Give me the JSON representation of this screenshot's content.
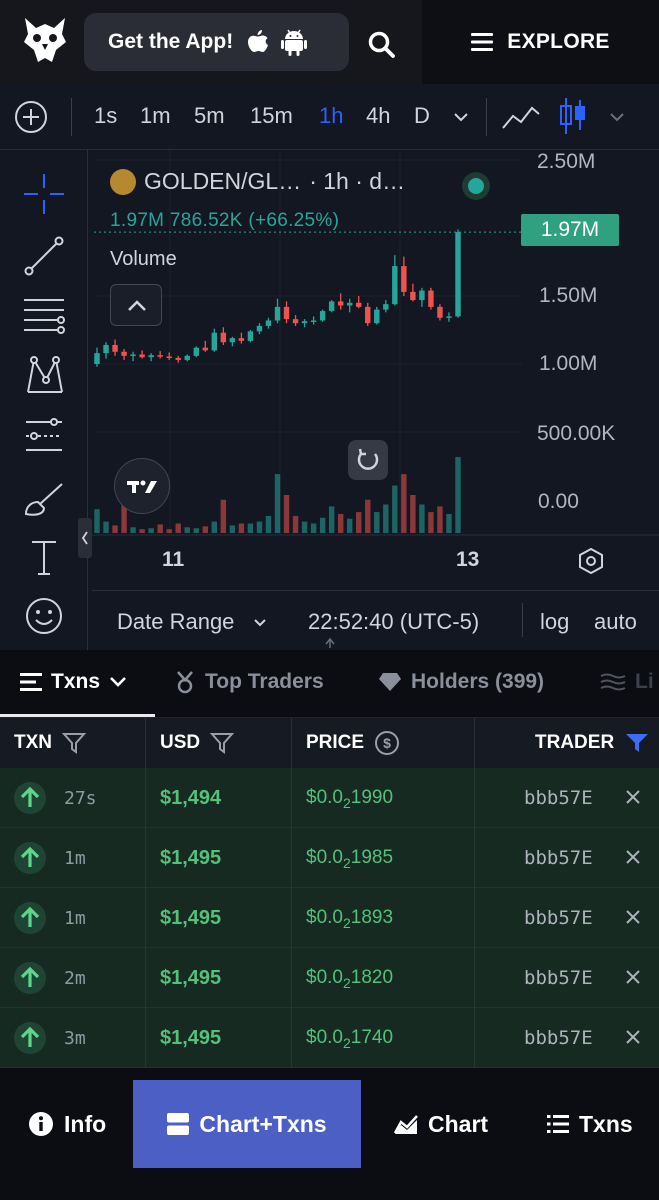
{
  "header": {
    "get_app_label": "Get the App!",
    "explore_label": "EXPLORE",
    "icons": [
      "owl-logo-icon",
      "apple-icon",
      "android-icon",
      "search-icon",
      "menu-icon"
    ]
  },
  "chart_toolbar": {
    "timeframes": [
      "1s",
      "1m",
      "5m",
      "15m",
      "1h",
      "4h",
      "D"
    ],
    "active_timeframe": "1h"
  },
  "chart": {
    "symbol": "GOLDEN/GL…",
    "interval_label": "· 1h · d…",
    "ohlc_text": "1.97M  786.52K (+66.25%)",
    "volume_label": "Volume",
    "last_price_tag": "1.97M",
    "y_axis_ticks": [
      "2.50M",
      "1.50M",
      "1.00M",
      "500.00K",
      "0.00"
    ],
    "x_axis_ticks": [
      "11",
      "13"
    ],
    "date_range_label": "Date Range",
    "clock": "22:52:40 (UTC-5)",
    "log_label": "log",
    "auto_label": "auto",
    "colors": {
      "up": "#26a69a",
      "down": "#ef5350",
      "accent": "#2962ff"
    }
  },
  "chart_data": {
    "type": "candlestick",
    "ylim": [
      0,
      2500000
    ],
    "x_ticks": [
      "11",
      "13"
    ],
    "candles": [
      {
        "o": 1000000,
        "h": 1120000,
        "l": 980000,
        "c": 1080000
      },
      {
        "o": 1080000,
        "h": 1160000,
        "l": 1040000,
        "c": 1140000
      },
      {
        "o": 1140000,
        "h": 1180000,
        "l": 1060000,
        "c": 1090000
      },
      {
        "o": 1090000,
        "h": 1110000,
        "l": 1030000,
        "c": 1060000
      },
      {
        "o": 1060000,
        "h": 1090000,
        "l": 1020000,
        "c": 1070000
      },
      {
        "o": 1070000,
        "h": 1100000,
        "l": 1040000,
        "c": 1050000
      },
      {
        "o": 1050000,
        "h": 1080000,
        "l": 1020000,
        "c": 1065000
      },
      {
        "o": 1065000,
        "h": 1095000,
        "l": 1040000,
        "c": 1055000
      },
      {
        "o": 1055000,
        "h": 1085000,
        "l": 1030000,
        "c": 1045000
      },
      {
        "o": 1045000,
        "h": 1060000,
        "l": 1010000,
        "c": 1030000
      },
      {
        "o": 1030000,
        "h": 1070000,
        "l": 1020000,
        "c": 1060000
      },
      {
        "o": 1060000,
        "h": 1130000,
        "l": 1050000,
        "c": 1120000
      },
      {
        "o": 1120000,
        "h": 1170000,
        "l": 1090000,
        "c": 1100000
      },
      {
        "o": 1100000,
        "h": 1260000,
        "l": 1090000,
        "c": 1230000
      },
      {
        "o": 1230000,
        "h": 1270000,
        "l": 1140000,
        "c": 1160000
      },
      {
        "o": 1160000,
        "h": 1200000,
        "l": 1130000,
        "c": 1190000
      },
      {
        "o": 1190000,
        "h": 1230000,
        "l": 1150000,
        "c": 1170000
      },
      {
        "o": 1170000,
        "h": 1250000,
        "l": 1160000,
        "c": 1240000
      },
      {
        "o": 1240000,
        "h": 1300000,
        "l": 1220000,
        "c": 1280000
      },
      {
        "o": 1280000,
        "h": 1340000,
        "l": 1260000,
        "c": 1320000
      },
      {
        "o": 1320000,
        "h": 1480000,
        "l": 1300000,
        "c": 1420000
      },
      {
        "o": 1420000,
        "h": 1460000,
        "l": 1300000,
        "c": 1330000
      },
      {
        "o": 1330000,
        "h": 1360000,
        "l": 1280000,
        "c": 1300000
      },
      {
        "o": 1300000,
        "h": 1330000,
        "l": 1270000,
        "c": 1315000
      },
      {
        "o": 1315000,
        "h": 1350000,
        "l": 1290000,
        "c": 1320000
      },
      {
        "o": 1320000,
        "h": 1400000,
        "l": 1310000,
        "c": 1390000
      },
      {
        "o": 1390000,
        "h": 1470000,
        "l": 1380000,
        "c": 1460000
      },
      {
        "o": 1460000,
        "h": 1520000,
        "l": 1400000,
        "c": 1430000
      },
      {
        "o": 1430000,
        "h": 1480000,
        "l": 1380000,
        "c": 1450000
      },
      {
        "o": 1450000,
        "h": 1500000,
        "l": 1410000,
        "c": 1420000
      },
      {
        "o": 1420000,
        "h": 1450000,
        "l": 1280000,
        "c": 1300000
      },
      {
        "o": 1300000,
        "h": 1420000,
        "l": 1290000,
        "c": 1400000
      },
      {
        "o": 1400000,
        "h": 1470000,
        "l": 1380000,
        "c": 1440000
      },
      {
        "o": 1440000,
        "h": 1800000,
        "l": 1430000,
        "c": 1720000
      },
      {
        "o": 1720000,
        "h": 1790000,
        "l": 1500000,
        "c": 1530000
      },
      {
        "o": 1530000,
        "h": 1590000,
        "l": 1460000,
        "c": 1470000
      },
      {
        "o": 1470000,
        "h": 1560000,
        "l": 1420000,
        "c": 1540000
      },
      {
        "o": 1540000,
        "h": 1560000,
        "l": 1400000,
        "c": 1420000
      },
      {
        "o": 1420000,
        "h": 1440000,
        "l": 1320000,
        "c": 1340000
      },
      {
        "o": 1340000,
        "h": 1380000,
        "l": 1310000,
        "c": 1350000
      },
      {
        "o": 1350000,
        "h": 1990000,
        "l": 1340000,
        "c": 1970000
      }
    ],
    "volumes": [
      0.25,
      0.12,
      0.08,
      0.3,
      0.06,
      0.04,
      0.05,
      0.09,
      0.04,
      0.1,
      0.06,
      0.05,
      0.07,
      0.12,
      0.35,
      0.08,
      0.1,
      0.1,
      0.12,
      0.18,
      0.62,
      0.4,
      0.18,
      0.12,
      0.1,
      0.16,
      0.28,
      0.2,
      0.15,
      0.22,
      0.35,
      0.22,
      0.3,
      0.5,
      0.62,
      0.4,
      0.3,
      0.22,
      0.28,
      0.2,
      0.8
    ]
  },
  "tabs": [
    {
      "label": "Txns",
      "icon": "list-icon"
    },
    {
      "label": "Top Traders",
      "icon": "medal-icon"
    },
    {
      "label": "Holders (399)",
      "icon": "diamond-icon"
    },
    {
      "label": "Li",
      "icon": "liquidity-icon"
    }
  ],
  "table": {
    "headers": {
      "txn": "TXN",
      "usd": "USD",
      "price": "PRICE",
      "trader": "TRADER"
    },
    "rows": [
      {
        "age": "27s",
        "usd": "$1,494",
        "price_prefix": "$0.0",
        "price_zeros": "2",
        "price_digits": "1990",
        "trader": "bbb57E"
      },
      {
        "age": "1m",
        "usd": "$1,495",
        "price_prefix": "$0.0",
        "price_zeros": "2",
        "price_digits": "1985",
        "trader": "bbb57E"
      },
      {
        "age": "1m",
        "usd": "$1,495",
        "price_prefix": "$0.0",
        "price_zeros": "2",
        "price_digits": "1893",
        "trader": "bbb57E"
      },
      {
        "age": "2m",
        "usd": "$1,495",
        "price_prefix": "$0.0",
        "price_zeros": "2",
        "price_digits": "1820",
        "trader": "bbb57E"
      },
      {
        "age": "3m",
        "usd": "$1,495",
        "price_prefix": "$0.0",
        "price_zeros": "2",
        "price_digits": "1740",
        "trader": "bbb57E"
      }
    ]
  },
  "bottom_nav": {
    "info": "Info",
    "chart_txns": "Chart+Txns",
    "chart": "Chart",
    "txns": "Txns",
    "active": "chart_txns"
  }
}
